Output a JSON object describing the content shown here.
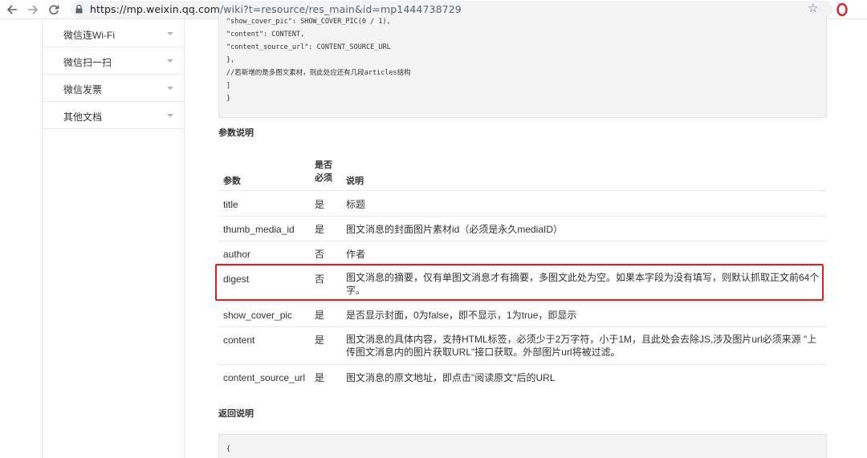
{
  "browser": {
    "url_host": "https://mp.weixin.qq.com",
    "url_path": "/wiki?t=resource/res_main&id=mp1444738729",
    "back_icon": "arrow-left-icon",
    "forward_icon": "arrow-right-icon",
    "reload_icon": "reload-icon",
    "lock_icon": "lock-icon",
    "bookmark_icon": "star-icon",
    "extension_icon": "opera-icon"
  },
  "sidebar": {
    "items": [
      {
        "label": "微信连Wi-Fi"
      },
      {
        "label": "微信扫一扫"
      },
      {
        "label": "微信发票"
      },
      {
        "label": "其他文档"
      }
    ]
  },
  "code_top": {
    "lines": [
      "\"show_cover_pic\": SHOW_COVER_PIC(0 / 1),",
      "\"content\": CONTENT,",
      "\"content_source_url\": CONTENT_SOURCE_URL",
      "},",
      "//若新增的是多图文素材，则此处应还有几段articles结构",
      "]",
      "}"
    ]
  },
  "params_heading": "参数说明",
  "table": {
    "headers": {
      "param": "参数",
      "required": "是否必须",
      "desc": "说明"
    },
    "rows": [
      {
        "param": "title",
        "required": "是",
        "desc": "标题"
      },
      {
        "param": "thumb_media_id",
        "required": "是",
        "desc": "图文消息的封面图片素材id（必须是永久mediaID）"
      },
      {
        "param": "author",
        "required": "否",
        "desc": "作者"
      },
      {
        "param": "digest",
        "required": "否",
        "desc": "图文消息的摘要，仅有单图文消息才有摘要，多图文此处为空。如果本字段为没有填写，则默认抓取正文前64个字。"
      },
      {
        "param": "show_cover_pic",
        "required": "是",
        "desc": "是否显示封面，0为false，即不显示，1为true，即显示"
      },
      {
        "param": "content",
        "required": "是",
        "desc": "图文消息的具体内容，支持HTML标签，必须少于2万字符，小于1M，且此处会去除JS,涉及图片url必须来源 \"上传图文消息内的图片获取URL\"接口获取。外部图片url将被过滤。"
      },
      {
        "param": "content_source_url",
        "required": "是",
        "desc": "图文消息的原文地址，即点击\"阅读原文\"后的URL"
      }
    ]
  },
  "return_heading": "返回说明",
  "code_bottom": {
    "first_line": "{"
  },
  "highlight_color": "#e02020"
}
